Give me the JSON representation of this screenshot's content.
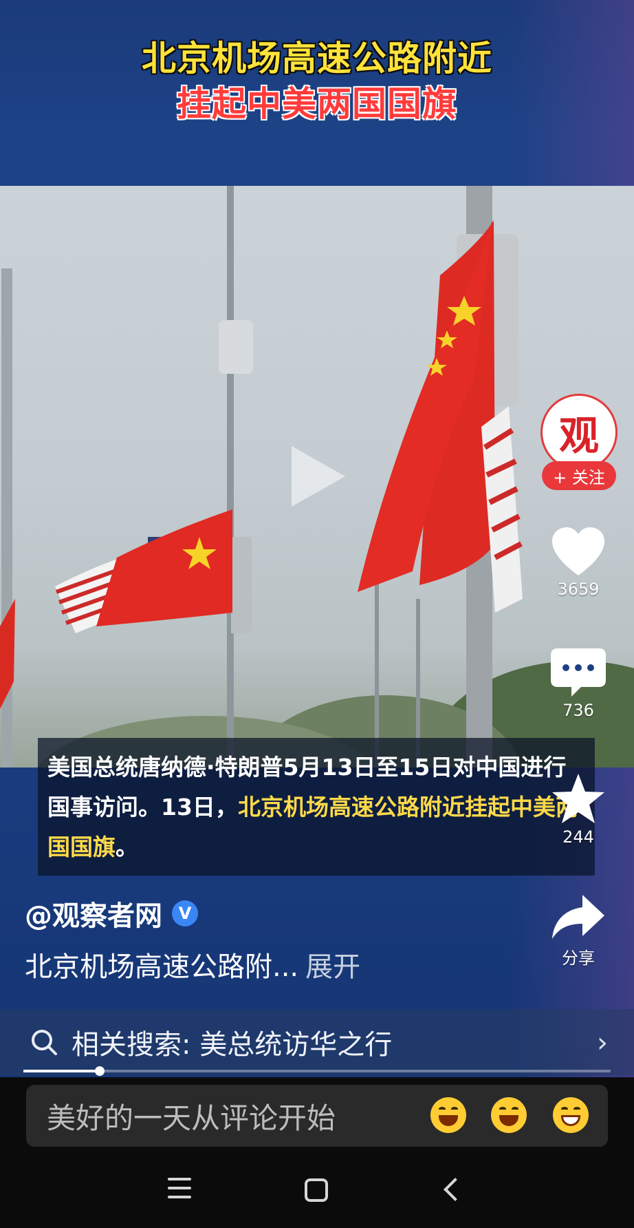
{
  "headline": {
    "line1": "北京机场高速公路附近",
    "line2": "挂起中美两国国旗"
  },
  "caption": {
    "part1": "美国总统唐纳德·特朗普5月13日至15日对中国进行国事访问。13日，",
    "highlight": "北京机场高速公路附近挂起中美两国国旗",
    "end": "。"
  },
  "sidebar": {
    "avatar_logo": "观",
    "follow_label": "+ 关注",
    "like_count": "3659",
    "comment_count": "736",
    "favorite_count": "244",
    "share_label": "分享"
  },
  "author": {
    "handle": "@观察者网",
    "verified_mark": "V"
  },
  "description": {
    "text": "北京机场高速公路附...",
    "more": "展开"
  },
  "related_search": {
    "text": "相关搜索: 美总统访华之行",
    "chevron": "›"
  },
  "playback": {
    "progress": 0.13
  },
  "comment_bar": {
    "placeholder": "美好的一天从评论开始"
  },
  "colors": {
    "accent_red": "#e8383c",
    "headline_yellow": "#ffe23a",
    "caption_highlight": "#ffd94a",
    "verified_blue": "#3b86f5"
  }
}
